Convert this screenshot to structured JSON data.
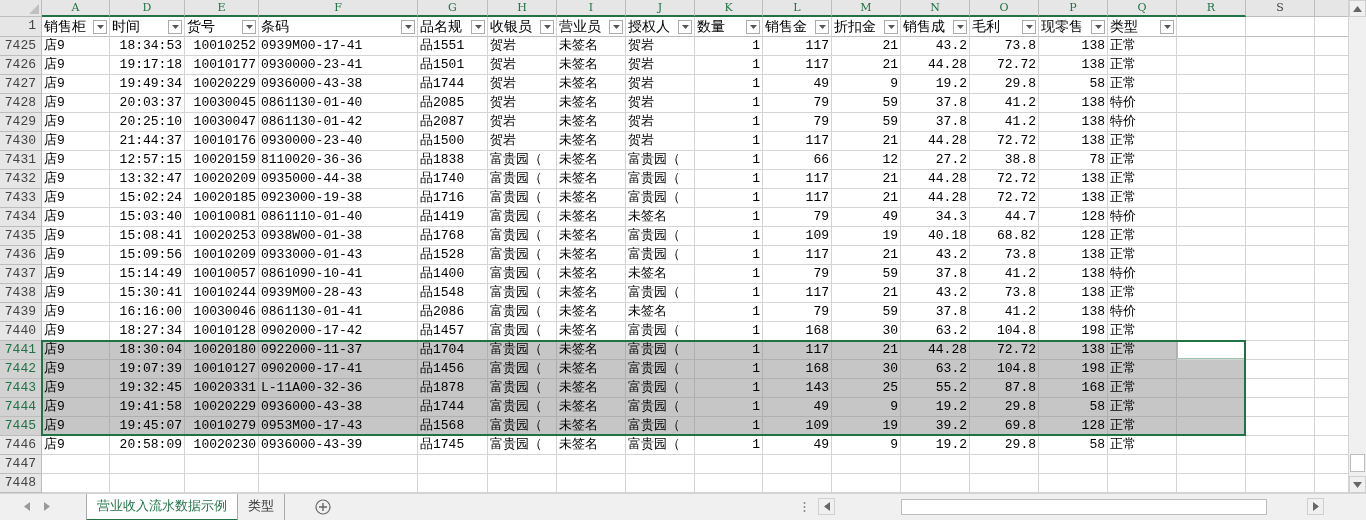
{
  "sheet": {
    "header_row_number": "1",
    "columns": [
      {
        "letter": "A",
        "header": "销售柜",
        "kind": "text",
        "filter": true,
        "selected": true
      },
      {
        "letter": "D",
        "header": "时间",
        "kind": "number",
        "filter": true,
        "selected": true
      },
      {
        "letter": "E",
        "header": "货号",
        "kind": "number",
        "filter": true,
        "selected": true
      },
      {
        "letter": "F",
        "header": "条码",
        "kind": "text",
        "filter": true,
        "selected": true
      },
      {
        "letter": "G",
        "header": "品名规",
        "kind": "text",
        "filter": true,
        "selected": true
      },
      {
        "letter": "H",
        "header": "收银员",
        "kind": "text",
        "filter": true,
        "selected": true
      },
      {
        "letter": "I",
        "header": "营业员",
        "kind": "text",
        "filter": true,
        "selected": true
      },
      {
        "letter": "J",
        "header": "授权人",
        "kind": "text",
        "filter": true,
        "selected": true
      },
      {
        "letter": "K",
        "header": "数量",
        "kind": "number",
        "filter": true,
        "selected": true
      },
      {
        "letter": "L",
        "header": "销售金",
        "kind": "number",
        "filter": true,
        "selected": true
      },
      {
        "letter": "M",
        "header": "折扣金",
        "kind": "number",
        "filter": true,
        "selected": true
      },
      {
        "letter": "N",
        "header": "销售成",
        "kind": "number",
        "filter": true,
        "selected": true
      },
      {
        "letter": "O",
        "header": "毛利",
        "kind": "number",
        "filter": true,
        "selected": true
      },
      {
        "letter": "P",
        "header": "现零售",
        "kind": "number",
        "filter": true,
        "selected": true
      },
      {
        "letter": "Q",
        "header": "类型",
        "kind": "text",
        "filter": true,
        "selected": true
      },
      {
        "letter": "R",
        "kind": "text",
        "filter": false,
        "selected": true
      },
      {
        "letter": "S",
        "kind": "text",
        "filter": false,
        "selected": false
      }
    ],
    "rows": [
      {
        "number": "7425",
        "selected": false,
        "active": false,
        "cells": [
          "店9",
          "18:34:53",
          "10010252",
          "0939M00-17-41",
          "品1551",
          "贺岩",
          "未签名",
          "贺岩",
          "1",
          "117",
          "21",
          "43.2",
          "73.8",
          "138",
          "正常"
        ]
      },
      {
        "number": "7426",
        "selected": false,
        "active": false,
        "cells": [
          "店9",
          "19:17:18",
          "10010177",
          "0930000-23-41",
          "品1501",
          "贺岩",
          "未签名",
          "贺岩",
          "1",
          "117",
          "21",
          "44.28",
          "72.72",
          "138",
          "正常"
        ]
      },
      {
        "number": "7427",
        "selected": false,
        "active": false,
        "cells": [
          "店9",
          "19:49:34",
          "10020229",
          "0936000-43-38",
          "品1744",
          "贺岩",
          "未签名",
          "贺岩",
          "1",
          "49",
          "9",
          "19.2",
          "29.8",
          "58",
          "正常"
        ]
      },
      {
        "number": "7428",
        "selected": false,
        "active": false,
        "cells": [
          "店9",
          "20:03:37",
          "10030045",
          "0861130-01-40",
          "品2085",
          "贺岩",
          "未签名",
          "贺岩",
          "1",
          "79",
          "59",
          "37.8",
          "41.2",
          "138",
          "特价"
        ]
      },
      {
        "number": "7429",
        "selected": false,
        "active": false,
        "cells": [
          "店9",
          "20:25:10",
          "10030047",
          "0861130-01-42",
          "品2087",
          "贺岩",
          "未签名",
          "贺岩",
          "1",
          "79",
          "59",
          "37.8",
          "41.2",
          "138",
          "特价"
        ]
      },
      {
        "number": "7430",
        "selected": false,
        "active": false,
        "cells": [
          "店9",
          "21:44:37",
          "10010176",
          "0930000-23-40",
          "品1500",
          "贺岩",
          "未签名",
          "贺岩",
          "1",
          "117",
          "21",
          "44.28",
          "72.72",
          "138",
          "正常"
        ]
      },
      {
        "number": "7431",
        "selected": false,
        "active": false,
        "cells": [
          "店9",
          "12:57:15",
          "10020159",
          "8110020-36-36",
          "品1838",
          "富贵园（",
          "未签名",
          "富贵园（",
          "1",
          "66",
          "12",
          "27.2",
          "38.8",
          "78",
          "正常"
        ]
      },
      {
        "number": "7432",
        "selected": false,
        "active": false,
        "cells": [
          "店9",
          "13:32:47",
          "10020209",
          "0935000-44-38",
          "品1740",
          "富贵园（",
          "未签名",
          "富贵园（",
          "1",
          "117",
          "21",
          "44.28",
          "72.72",
          "138",
          "正常"
        ]
      },
      {
        "number": "7433",
        "selected": false,
        "active": false,
        "cells": [
          "店9",
          "15:02:24",
          "10020185",
          "0923000-19-38",
          "品1716",
          "富贵园（",
          "未签名",
          "富贵园（",
          "1",
          "117",
          "21",
          "44.28",
          "72.72",
          "138",
          "正常"
        ]
      },
      {
        "number": "7434",
        "selected": false,
        "active": false,
        "cells": [
          "店9",
          "15:03:40",
          "10010081",
          "0861110-01-40",
          "品1419",
          "富贵园（",
          "未签名",
          "未签名",
          "1",
          "79",
          "49",
          "34.3",
          "44.7",
          "128",
          "特价"
        ]
      },
      {
        "number": "7435",
        "selected": false,
        "active": false,
        "cells": [
          "店9",
          "15:08:41",
          "10020253",
          "0938W00-01-38",
          "品1768",
          "富贵园（",
          "未签名",
          "富贵园（",
          "1",
          "109",
          "19",
          "40.18",
          "68.82",
          "128",
          "正常"
        ]
      },
      {
        "number": "7436",
        "selected": false,
        "active": false,
        "cells": [
          "店9",
          "15:09:56",
          "10010209",
          "0933000-01-43",
          "品1528",
          "富贵园（",
          "未签名",
          "富贵园（",
          "1",
          "117",
          "21",
          "43.2",
          "73.8",
          "138",
          "正常"
        ]
      },
      {
        "number": "7437",
        "selected": false,
        "active": false,
        "cells": [
          "店9",
          "15:14:49",
          "10010057",
          "0861090-10-41",
          "品1400",
          "富贵园（",
          "未签名",
          "未签名",
          "1",
          "79",
          "59",
          "37.8",
          "41.2",
          "138",
          "特价"
        ]
      },
      {
        "number": "7438",
        "selected": false,
        "active": false,
        "cells": [
          "店9",
          "15:30:41",
          "10010244",
          "0939M00-28-43",
          "品1548",
          "富贵园（",
          "未签名",
          "富贵园（",
          "1",
          "117",
          "21",
          "43.2",
          "73.8",
          "138",
          "正常"
        ]
      },
      {
        "number": "7439",
        "selected": false,
        "active": false,
        "cells": [
          "店9",
          "16:16:00",
          "10030046",
          "0861130-01-41",
          "品2086",
          "富贵园（",
          "未签名",
          "未签名",
          "1",
          "79",
          "59",
          "37.8",
          "41.2",
          "138",
          "特价"
        ]
      },
      {
        "number": "7440",
        "selected": false,
        "active": false,
        "cells": [
          "店9",
          "18:27:34",
          "10010128",
          "0902000-17-42",
          "品1457",
          "富贵园（",
          "未签名",
          "富贵园（",
          "1",
          "168",
          "30",
          "63.2",
          "104.8",
          "198",
          "正常"
        ]
      },
      {
        "number": "7441",
        "selected": true,
        "active": true,
        "cells": [
          "店9",
          "18:30:04",
          "10020180",
          "0922000-11-37",
          "品1704",
          "富贵园（",
          "未签名",
          "富贵园（",
          "1",
          "117",
          "21",
          "44.28",
          "72.72",
          "138",
          "正常"
        ]
      },
      {
        "number": "7442",
        "selected": true,
        "active": false,
        "cells": [
          "店9",
          "19:07:39",
          "10010127",
          "0902000-17-41",
          "品1456",
          "富贵园（",
          "未签名",
          "富贵园（",
          "1",
          "168",
          "30",
          "63.2",
          "104.8",
          "198",
          "正常"
        ]
      },
      {
        "number": "7443",
        "selected": true,
        "active": false,
        "cells": [
          "店9",
          "19:32:45",
          "10020331",
          "L-11A00-32-36",
          "品1878",
          "富贵园（",
          "未签名",
          "富贵园（",
          "1",
          "143",
          "25",
          "55.2",
          "87.8",
          "168",
          "正常"
        ]
      },
      {
        "number": "7444",
        "selected": true,
        "active": false,
        "cells": [
          "店9",
          "19:41:58",
          "10020229",
          "0936000-43-38",
          "品1744",
          "富贵园（",
          "未签名",
          "富贵园（",
          "1",
          "49",
          "9",
          "19.2",
          "29.8",
          "58",
          "正常"
        ]
      },
      {
        "number": "7445",
        "selected": true,
        "active": false,
        "cells": [
          "店9",
          "19:45:07",
          "10010279",
          "0953M00-17-43",
          "品1568",
          "富贵园（",
          "未签名",
          "富贵园（",
          "1",
          "109",
          "19",
          "39.2",
          "69.8",
          "128",
          "正常"
        ]
      },
      {
        "number": "7446",
        "selected": false,
        "active": false,
        "cells": [
          "店9",
          "20:58:09",
          "10020230",
          "0936000-43-39",
          "品1745",
          "富贵园（",
          "未签名",
          "富贵园（",
          "1",
          "49",
          "9",
          "19.2",
          "29.8",
          "58",
          "正常"
        ]
      },
      {
        "number": "7447",
        "selected": false,
        "active": false,
        "cells": []
      },
      {
        "number": "7448",
        "selected": false,
        "active": false,
        "cells": []
      }
    ]
  },
  "sheet_tabs": [
    {
      "label": "营业收入流水数据示例",
      "selected": true
    },
    {
      "label": "类型",
      "selected": false
    }
  ]
}
